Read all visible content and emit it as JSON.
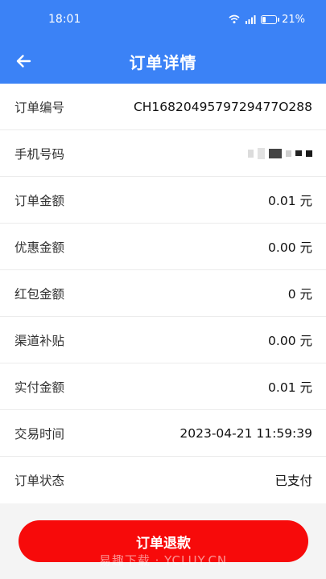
{
  "status_bar": {
    "time": "18:01",
    "battery": "21%",
    "battery_level": 0.21,
    "icons": [
      "wifi-icon",
      "signal-icon",
      "battery-icon"
    ]
  },
  "header": {
    "title": "订单详情",
    "back_icon": "arrow-left-icon",
    "background": "#3b82f6"
  },
  "details": [
    {
      "label": "订单编号",
      "value": "CH1682049579729477O288"
    },
    {
      "label": "手机号码",
      "value": ""
    },
    {
      "label": "订单金额",
      "value": "0.01 元"
    },
    {
      "label": "优惠金额",
      "value": "0.00 元"
    },
    {
      "label": "红包金额",
      "value": "0 元"
    },
    {
      "label": "渠道补贴",
      "value": "0.00 元"
    },
    {
      "label": "实付金额",
      "value": "0.01 元"
    },
    {
      "label": "交易时间",
      "value": "2023-04-21 11:59:39"
    },
    {
      "label": "订单状态",
      "value": "已支付"
    }
  ],
  "refund_button": {
    "label": "订单退款",
    "color": "#f70a0a"
  },
  "watermark": "易趣下载 · YCLUY.CN"
}
